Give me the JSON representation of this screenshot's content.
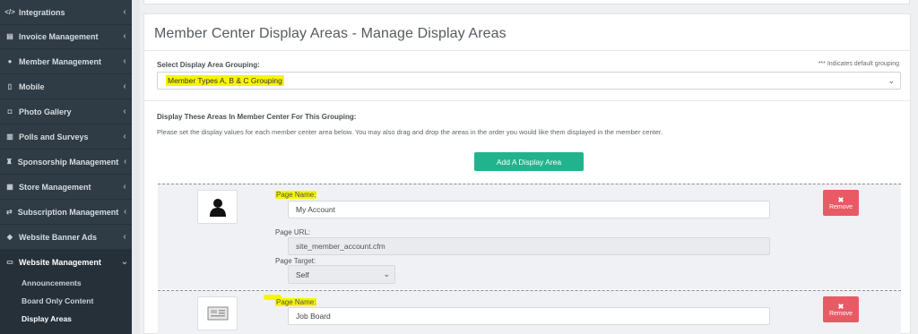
{
  "sidebar": {
    "items": [
      {
        "label": "Integrations",
        "icon": "code-icon",
        "glyph": "</>"
      },
      {
        "label": "Invoice Management",
        "icon": "file-icon",
        "glyph": "▤"
      },
      {
        "label": "Member Management",
        "icon": "user-icon",
        "glyph": "●"
      },
      {
        "label": "Mobile",
        "icon": "mobile-icon",
        "glyph": "▯"
      },
      {
        "label": "Photo Gallery",
        "icon": "camera-icon",
        "glyph": "◘"
      },
      {
        "label": "Polls and Surveys",
        "icon": "bar-chart-icon",
        "glyph": "▥"
      },
      {
        "label": "Sponsorship Management",
        "icon": "trophy-icon",
        "glyph": "♜"
      },
      {
        "label": "Store Management",
        "icon": "store-icon",
        "glyph": "▦"
      },
      {
        "label": "Subscription Management",
        "icon": "exchange-icon",
        "glyph": "⇄"
      },
      {
        "label": "Website Banner Ads",
        "icon": "tag-icon",
        "glyph": "◆"
      },
      {
        "label": "Website Management",
        "icon": "laptop-icon",
        "glyph": "▭"
      }
    ],
    "chevron_left": "‹",
    "chevron_down": "⌄",
    "sub_items": [
      {
        "label": "Announcements"
      },
      {
        "label": "Board Only Content"
      },
      {
        "label": "Display Areas"
      }
    ]
  },
  "main": {
    "title": "Member Center Display Areas - Manage Display Areas",
    "grouping_label": "Select Display Area Grouping:",
    "default_note": "*** Indicates default grouping",
    "grouping_value": "Member Types A, B & C Grouping",
    "areas_heading": "Display These Areas In Member Center For This Grouping:",
    "description": "Please set the display values for each member center area below. You may also drag and drop the areas in the order you would like them displayed in the member center.",
    "add_button": "Add A Display Area",
    "areas": [
      {
        "page_name_label": "Page Name:",
        "page_name": "My Account",
        "page_url_label": "Page URL:",
        "page_url": "site_member_account.cfm",
        "page_target_label": "Page Target:",
        "page_target": "Self",
        "remove_label": "Remove"
      },
      {
        "page_name_label": "Page Name:",
        "page_name": "Job Board",
        "remove_label": "Remove"
      }
    ]
  },
  "colors": {
    "sidebar_bg": "#2f3b45",
    "accent_green": "#22b38d",
    "remove_red": "#e85a64",
    "highlight_yellow": "#f7f500"
  }
}
